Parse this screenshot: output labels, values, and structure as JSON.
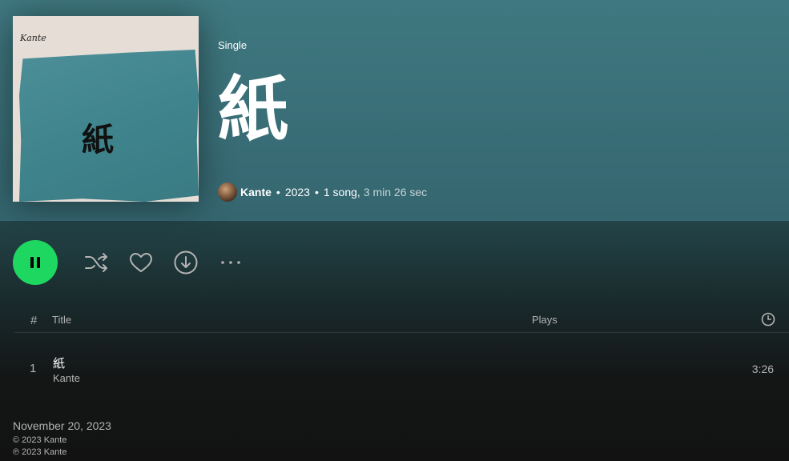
{
  "album": {
    "type_label": "Single",
    "title": "紙",
    "cover_artist_text": "Kante",
    "cover_title_text": "紙",
    "artist": "Kante",
    "year": "2023",
    "song_count": "1 song,",
    "duration": "3 min 26 sec"
  },
  "controls": {
    "accent_color": "#1ed760",
    "icons": [
      "pause-icon",
      "shuffle-icon",
      "heart-icon",
      "download-icon",
      "more-icon"
    ]
  },
  "table": {
    "headers": {
      "number": "#",
      "title": "Title",
      "plays": "Plays",
      "duration_icon": "clock-icon"
    },
    "rows": [
      {
        "number": "1",
        "title": "紙",
        "artist": "Kante",
        "plays": "",
        "duration": "3:26"
      }
    ]
  },
  "footer": {
    "release_date": "November 20, 2023",
    "copyright": "© 2023 Kante",
    "phonographic": "℗ 2023 Kante"
  }
}
